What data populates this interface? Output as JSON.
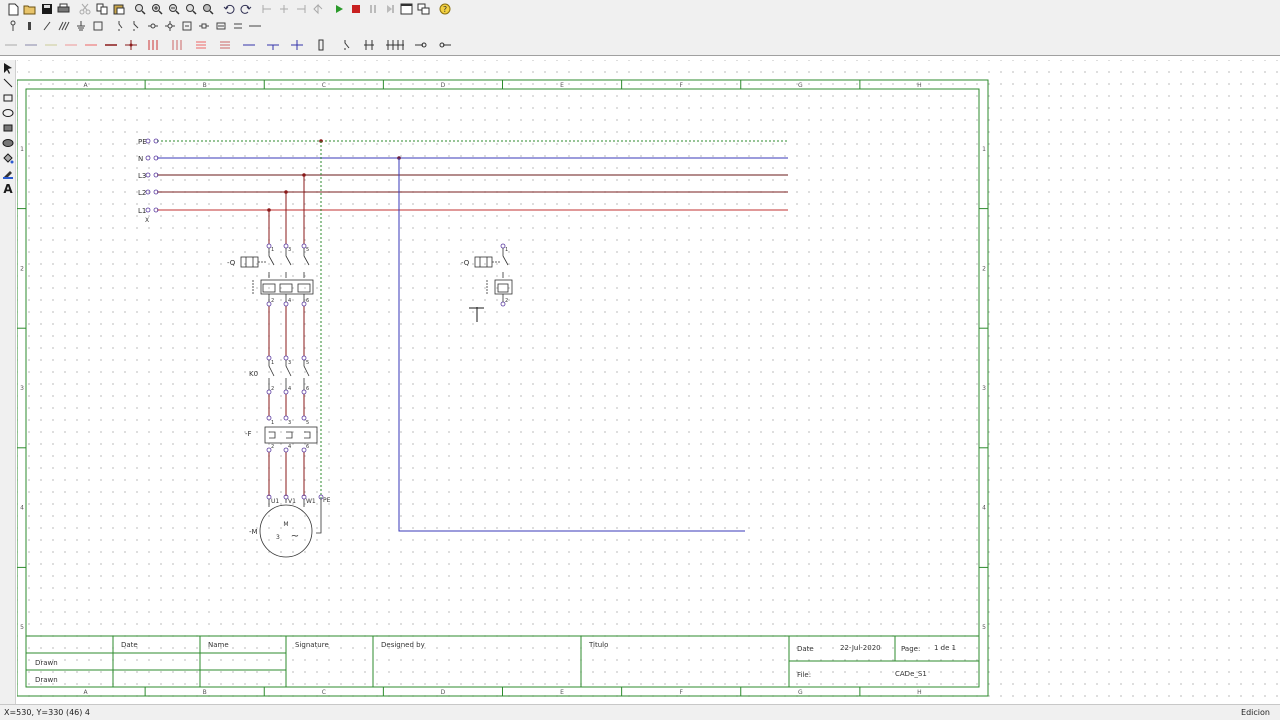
{
  "toolbar_main": {
    "icons": [
      "new-file-icon",
      "open-folder-icon",
      "save-icon",
      "print-icon",
      "cut-icon",
      "copy-icon",
      "paste-icon",
      "zoom-icon",
      "zoom-in-icon",
      "zoom-out-icon",
      "zoom-fit-icon",
      "undo-icon",
      "redo-icon",
      "align-left-icon",
      "align-center-icon",
      "align-right-icon",
      "step-back-icon",
      "play-icon",
      "stop-icon",
      "pause-icon",
      "step-forward-icon",
      "window-icon",
      "window-tile-icon",
      "help-icon"
    ]
  },
  "drawing": {
    "columns": [
      "A",
      "B",
      "C",
      "D",
      "E",
      "F",
      "G",
      "H"
    ],
    "rows": [
      "1",
      "2",
      "3",
      "4",
      "5"
    ],
    "bus_labels": [
      "PE",
      "N",
      "L3",
      "L2",
      "L1"
    ],
    "bus_colors": {
      "pe": "#2e8b2e",
      "n": "#3a3ab8",
      "l3": "#6a1a1a",
      "l2": "#7a1f1f",
      "l1": "#c03030"
    },
    "breaker_label": "-Q",
    "breaker_terminals_top": [
      "1",
      "3",
      "5"
    ],
    "breaker_terminals_bottom": [
      "2",
      "4",
      "6"
    ],
    "contactor_label": "K0",
    "overload_label": "-F",
    "motor_label": "-M",
    "motor_letter": "M",
    "motor_phase": "3",
    "motor_symbol": "~",
    "motor_terminals": [
      "U1",
      "V1",
      "W1",
      "PE"
    ],
    "breaker2_label": "-Q"
  },
  "titleblock": {
    "date_col": "Date",
    "name_col": "Name",
    "signature_col": "Signature",
    "designed_by": "Designed by",
    "titulo": "Titulo",
    "drawn_1": "Drawn",
    "drawn_2": "Drawn",
    "date_label": "Date",
    "date_value": "22-Jul-2020",
    "page_label": "Page:",
    "page_value": "1 de 1",
    "file_label": "File:",
    "file_value": "CADe_S1"
  },
  "status": {
    "coordinates": "X=530, Y=330 (46) 4",
    "mode": "Edicion"
  }
}
